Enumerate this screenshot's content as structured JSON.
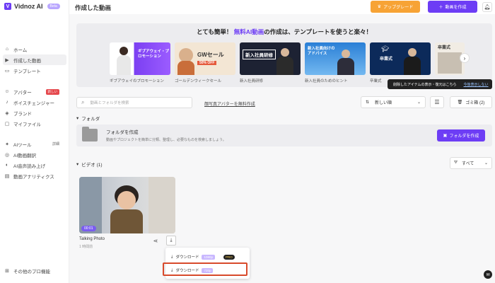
{
  "brand": {
    "name": "Vidnoz AI",
    "plan_badge": "Beta"
  },
  "sidebar": {
    "items": [
      {
        "label": "ホーム"
      },
      {
        "label": "作成した動画"
      },
      {
        "label": "テンプレート"
      },
      {
        "label": "アバター",
        "badge": "新しい"
      },
      {
        "label": "ボイスチェンジャー"
      },
      {
        "label": "ブランド"
      },
      {
        "label": "マイファイル"
      },
      {
        "label": "AIツール",
        "detail": "詳細"
      },
      {
        "label": "AI動画翻訳"
      },
      {
        "label": "AI音声読み上げ"
      },
      {
        "label": "動画アナリティクス"
      }
    ],
    "bottom_label": "その他のプロ機能"
  },
  "header": {
    "title": "作成した動画",
    "upgrade_label": "アップグレード",
    "create_label": "動画を作成"
  },
  "banner": {
    "title_pre": "とても簡単！",
    "title_highlight": "無料AI動画",
    "title_post": "の作成は、テンプレートを使うと楽々！",
    "templates": [
      {
        "label": "ギブアウェイのプロモーション",
        "thumb_text": "ギブアウェイ・プロモーション"
      },
      {
        "label": "ゴールデンウィークセール",
        "thumb_text": "GWセール",
        "thumb_sub": "50% OFF"
      },
      {
        "label": "新入社員研修",
        "thumb_text": "新入社員研修"
      },
      {
        "label": "新入社員のためのヒント",
        "thumb_text": "新入社員向けのアドバイス"
      },
      {
        "label": "卒業式",
        "thumb_text": "卒業式"
      },
      {
        "label": "",
        "thumb_text": "卒業式"
      }
    ]
  },
  "tooltip": {
    "text": "削除したアイテムの表示・復元はこちら",
    "link": "今後表示しない"
  },
  "toolbar": {
    "search_placeholder": "動画とフォルダを検索",
    "photo_avatar_link": "顔写真アバターを無料作成",
    "sort_label": "新しい順",
    "trash_label": "ゴミ箱 (2)"
  },
  "folders": {
    "section_label": "フォルダ",
    "create_title": "フォルダを作成",
    "create_desc": "動画やプロジェクトを簡単に分類、整理し、必要なものを検索しましょう。",
    "create_button": "フォルダを作成"
  },
  "videos": {
    "section_label": "ビデオ (1)",
    "filter_label": "すべて",
    "items": [
      {
        "title": "Talking Photo",
        "time": "1 時間前",
        "duration": "00:01"
      }
    ]
  },
  "download_menu": {
    "items": [
      {
        "label": "ダウンロード",
        "quality": "1080p",
        "pro": "PRO"
      },
      {
        "label": "ダウンロード",
        "quality": "720p"
      }
    ]
  },
  "colors": {
    "accent": "#6d3df5",
    "upgrade": "#f7a335",
    "highlight_border": "#d84a2b"
  }
}
